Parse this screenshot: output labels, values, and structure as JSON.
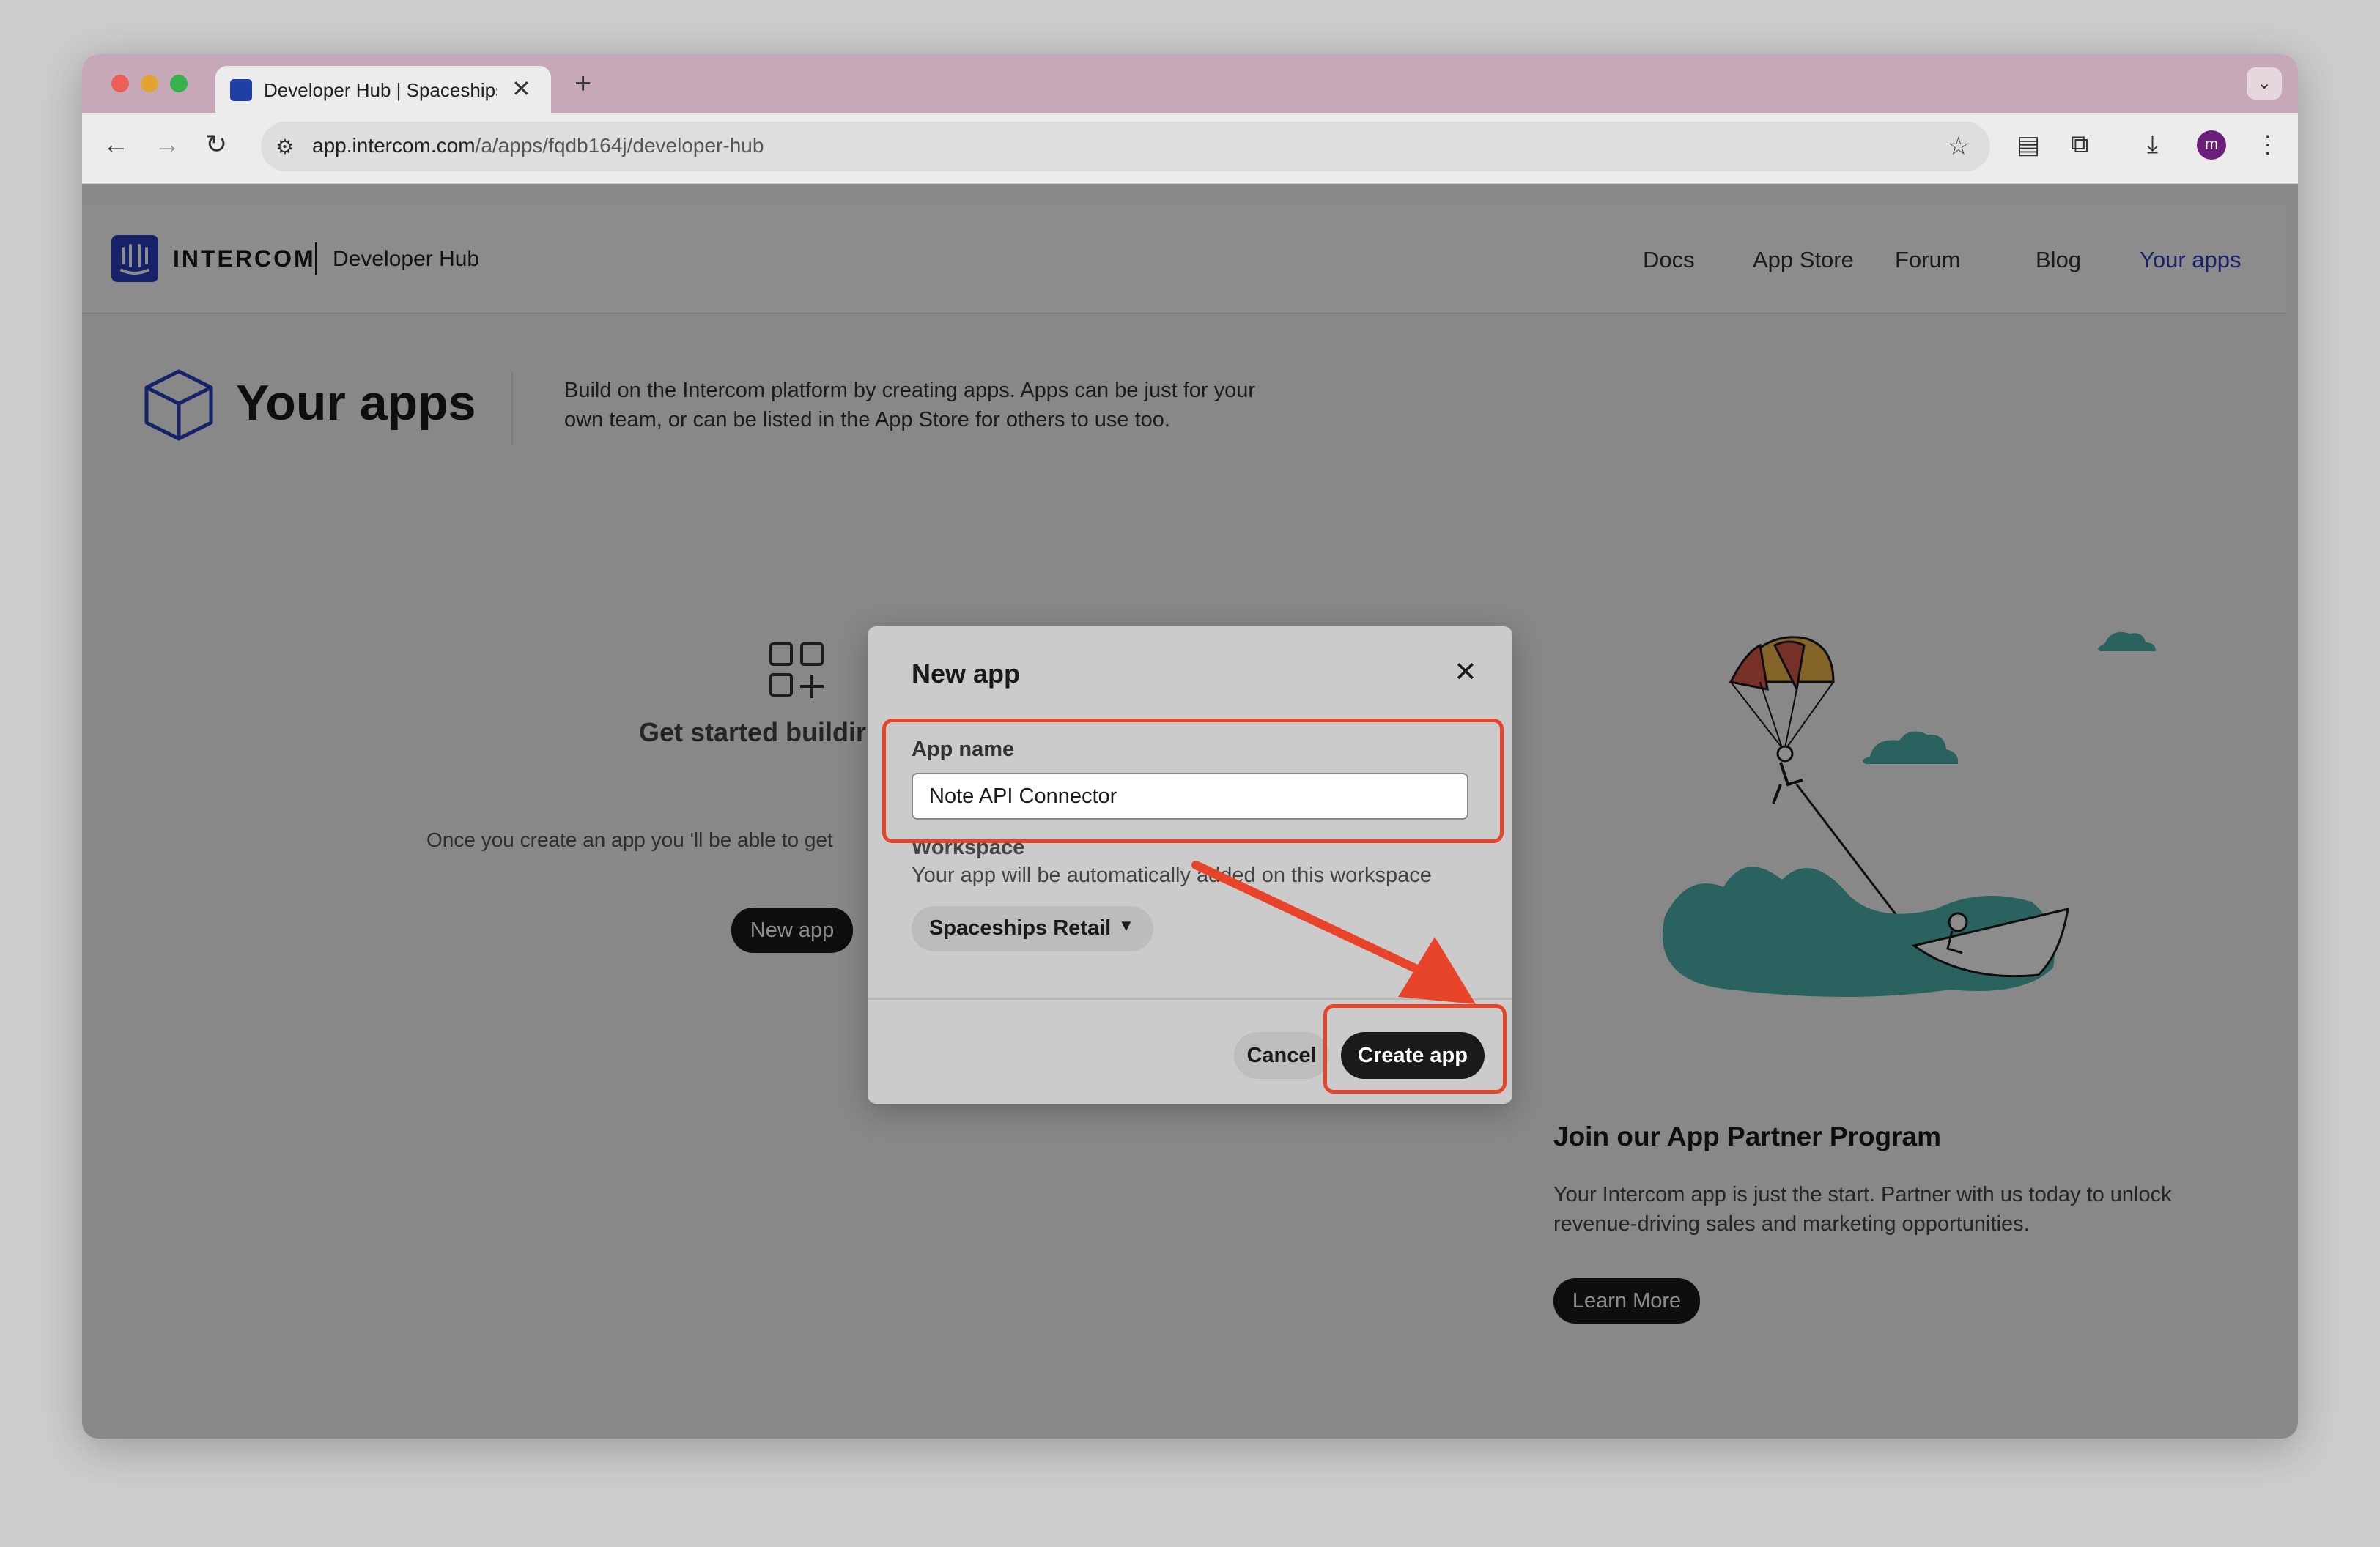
{
  "browser": {
    "tab_title": "Developer Hub | Spaceships R",
    "new_tab": "+",
    "tab_close": "✕",
    "tab_menu": "⌄",
    "url_host": "app.intercom.com",
    "url_path": "/a/apps/fqdb164j/developer-hub",
    "avatar_letter": "m"
  },
  "header": {
    "logo_text": "INTERCOM",
    "logo_sub": "Developer Hub",
    "nav": [
      "Docs",
      "App Store",
      "Forum",
      "Blog",
      "Your apps"
    ],
    "active_nav_color": "#2b3fbf"
  },
  "page": {
    "title": "Your apps",
    "description": "Build on the Intercom platform by creating apps. Apps can be just for your own team, or can be listed in the App Store for others to use too.",
    "empty_title": "Get started buildir",
    "empty_sub": "Once you create an app you 'll be able to get",
    "new_app_button": "New app",
    "partner_title": "Join our App Partner Program",
    "partner_desc": "Your Intercom app is just the start. Partner with us today to unlock revenue-driving sales and marketing opportunities.",
    "learn_more": "Learn More"
  },
  "modal": {
    "title": "New app",
    "close": "✕",
    "app_name_label": "App name",
    "app_name_value": "Note API Connector",
    "workspace_label": "Workspace",
    "workspace_desc": "Your app will be automatically added on this workspace",
    "workspace_value": "Spaceships Retail",
    "cancel": "Cancel",
    "create": "Create app"
  },
  "annotation_color": "#e8442a"
}
